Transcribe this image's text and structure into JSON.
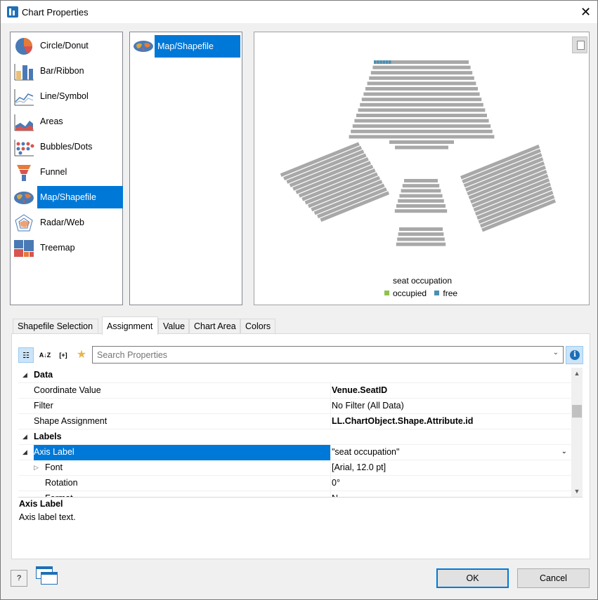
{
  "window": {
    "title": "Chart Properties",
    "close_glyph": "✕"
  },
  "chart_types": [
    {
      "label": "Circle/Donut",
      "icon": "pie-chart-icon"
    },
    {
      "label": "Bar/Ribbon",
      "icon": "bar-chart-icon"
    },
    {
      "label": "Line/Symbol",
      "icon": "line-chart-icon"
    },
    {
      "label": "Areas",
      "icon": "area-chart-icon"
    },
    {
      "label": "Bubbles/Dots",
      "icon": "bubble-chart-icon"
    },
    {
      "label": "Funnel",
      "icon": "funnel-chart-icon"
    },
    {
      "label": "Map/Shapefile",
      "icon": "map-icon",
      "selected": true
    },
    {
      "label": "Radar/Web",
      "icon": "radar-chart-icon"
    },
    {
      "label": "Treemap",
      "icon": "treemap-icon"
    }
  ],
  "sub_types": [
    {
      "label": "Map/Shapefile",
      "icon": "map-icon"
    }
  ],
  "preview": {
    "legend_title": "seat occupation",
    "legend": [
      {
        "label": "occupied",
        "color": "#8dc34b"
      },
      {
        "label": "free",
        "color": "#4a8fb3"
      }
    ],
    "seat_color": "#a8a8a8",
    "free_color": "#4a8fb3"
  },
  "tabs": [
    "Shapefile Selection",
    "Assignment",
    "Value",
    "Chart Area",
    "Colors"
  ],
  "active_tab": "Assignment",
  "toolbar": {
    "search_placeholder": "Search Properties",
    "sort_glyph": "A↓Z",
    "expand_glyph": "[+]",
    "favorite_glyph": "★",
    "info_glyph": "i",
    "categorized_glyph": "☷"
  },
  "property_grid": [
    {
      "type": "category",
      "label": "Data"
    },
    {
      "type": "prop",
      "key": "Coordinate Value",
      "value": "Venue.SeatID",
      "bold": true
    },
    {
      "type": "prop",
      "key": "Filter",
      "value": "No Filter (All Data)"
    },
    {
      "type": "prop",
      "key": "Shape Assignment",
      "value": "LL.ChartObject.Shape.Attribute.id",
      "bold": true
    },
    {
      "type": "category",
      "label": "Labels"
    },
    {
      "type": "prop",
      "key": "Axis Label",
      "value": "\"seat occupation\"",
      "selected": true,
      "expandable": true
    },
    {
      "type": "prop",
      "key": "Font",
      "value": "[Arial, 12.0 pt]",
      "sub": true,
      "expandable": true
    },
    {
      "type": "prop",
      "key": "Rotation",
      "value": "0°",
      "sub": true
    },
    {
      "type": "prop",
      "key": "Format",
      "value": "N",
      "sub": true
    }
  ],
  "description": {
    "title": "Axis Label",
    "text": "Axis label text."
  },
  "buttons": {
    "ok": "OK",
    "cancel": "Cancel",
    "help": "?"
  }
}
